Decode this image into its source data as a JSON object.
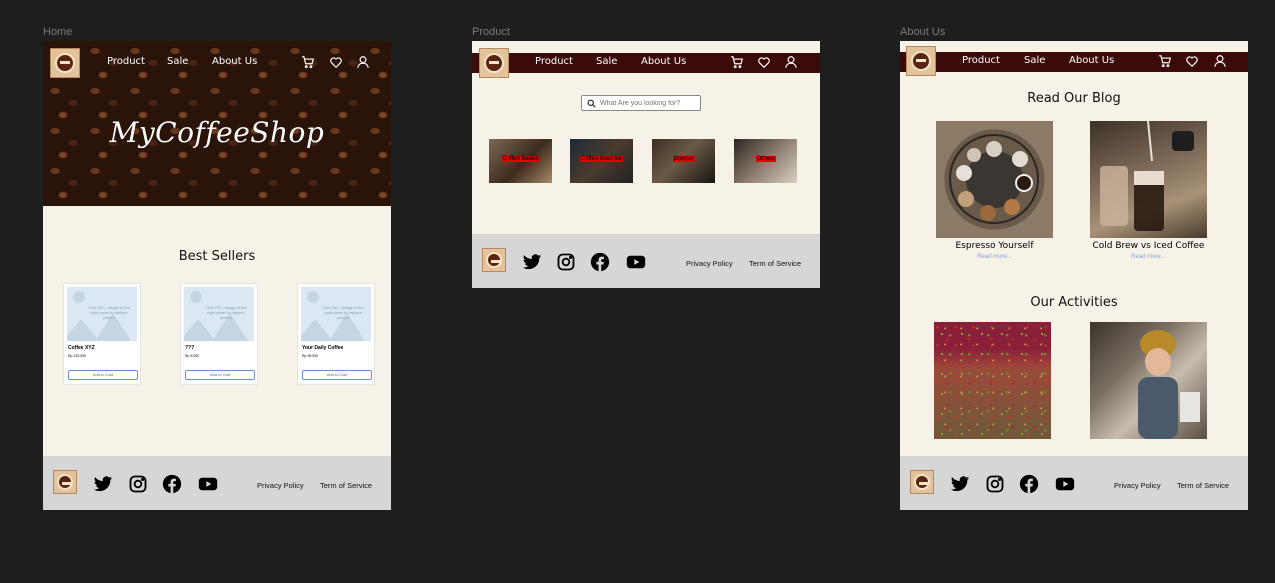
{
  "frames": {
    "home_label": "Home",
    "product_label": "Product",
    "about_label": "About Us"
  },
  "nav": {
    "product": "Product",
    "sale": "Sale",
    "about": "About Us"
  },
  "home": {
    "hero_title": "MyCoffeeShop",
    "best_sellers_title": "Best Sellers",
    "placeholder_hint": "Click Fill > Image in the right panel to replace picture",
    "products": [
      {
        "name": "Coffee XYZ",
        "price": "Rp 125.000",
        "button": "Add to Cart"
      },
      {
        "name": "???",
        "price": "Rp 5.000",
        "button": "Add to Cart"
      },
      {
        "name": "Your Daily Coffee",
        "price": "Rp 95.000",
        "button": "Add to Cart"
      }
    ]
  },
  "product_page": {
    "search_placeholder": "What Are you looking for?",
    "categories": [
      "Coffee Beans",
      "Coffee Machine",
      "Grinder",
      "Others"
    ]
  },
  "about_page": {
    "blog_title": "Read Our Blog",
    "posts": [
      {
        "title": "Espresso Yourself",
        "link": "Read more..."
      },
      {
        "title": "Cold Brew vs Iced Coffee",
        "link": "Read more..."
      }
    ],
    "activities_title": "Our Activities"
  },
  "footer": {
    "privacy": "Privacy Policy",
    "terms": "Term of Service"
  },
  "icons": [
    "cart-icon",
    "heart-icon",
    "user-icon",
    "twitter-icon",
    "instagram-icon",
    "facebook-icon",
    "youtube-icon",
    "search-icon",
    "logo"
  ],
  "colors": {
    "canvas": "#1e1e1e",
    "nav_bar": "#3a0b08",
    "page_bg": "#f6f2e8",
    "footer_bg": "#d6d6d6",
    "category_label": "#e00000"
  }
}
